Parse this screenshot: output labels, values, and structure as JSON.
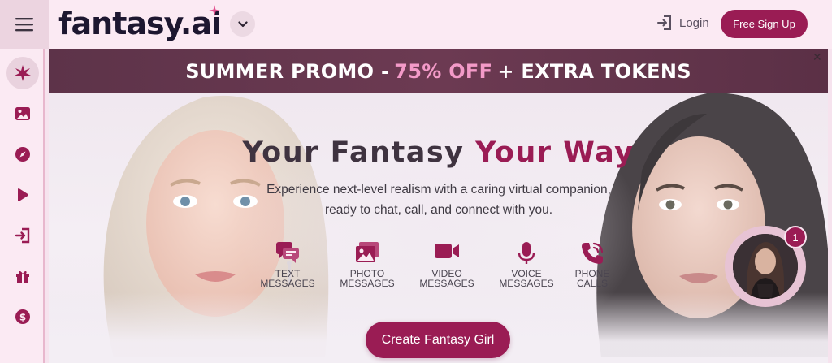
{
  "header": {
    "logo_text": "fantasy.ai",
    "login_label": "Login",
    "signup_label": "Free Sign Up"
  },
  "sidebar": {
    "items": [
      {
        "icon": "sparkle-icon",
        "active": true
      },
      {
        "icon": "image-icon"
      },
      {
        "icon": "compass-icon"
      },
      {
        "icon": "play-icon"
      },
      {
        "icon": "login-door-icon"
      },
      {
        "icon": "gift-icon"
      },
      {
        "icon": "dollar-icon"
      }
    ]
  },
  "promo": {
    "prefix": "SUMMER PROMO - ",
    "highlight": "75% OFF",
    "suffix": " + EXTRA TOKENS"
  },
  "hero": {
    "headline_part1": "Your Fantasy ",
    "headline_part2": "Your Way",
    "subline_line1": "Experience next-level realism with a caring virtual companion,",
    "subline_line2": "ready to chat, call, and connect with you.",
    "features": [
      {
        "line1": "TEXT",
        "line2": "MESSAGES",
        "icon": "chat-bubbles-icon"
      },
      {
        "line1": "PHOTO",
        "line2": "MESSAGES",
        "icon": "photo-icon"
      },
      {
        "line1": "VIDEO",
        "line2": "MESSAGES",
        "icon": "video-camera-icon"
      },
      {
        "line1": "VOICE",
        "line2": "MESSAGES",
        "icon": "microphone-icon"
      },
      {
        "line1": "PHONE",
        "line2": "CALLS",
        "icon": "phone-icon"
      }
    ],
    "cta_label": "Create Fantasy Girl"
  },
  "chat_bubble": {
    "badge_count": "1"
  },
  "colors": {
    "brand": "#9a1c54",
    "promo_bg": "#6c3a52",
    "promo_highlight": "#f39ac8",
    "page_bg": "#fbeaf3"
  }
}
